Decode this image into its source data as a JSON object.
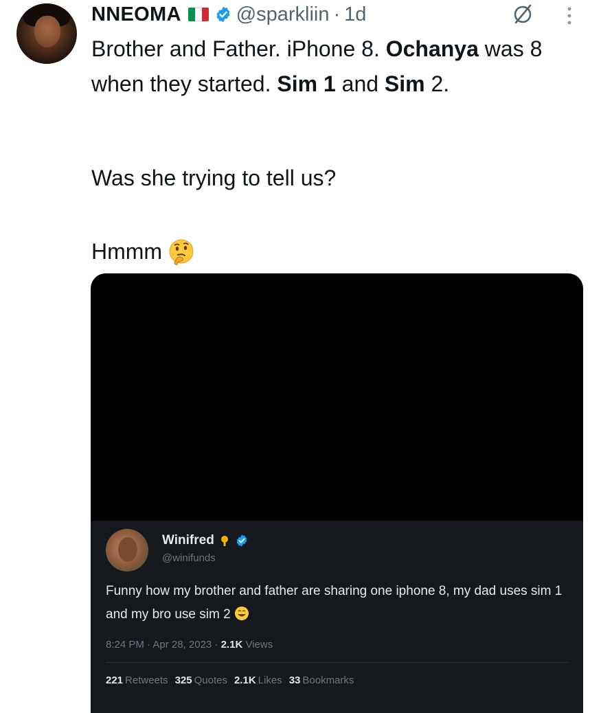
{
  "author": {
    "name": "NNEOMA",
    "handle": "@sparkliin",
    "separator": "·",
    "time": "1d"
  },
  "icons": {
    "flag": "italy-flag-icon",
    "verified": "verified-badge-icon",
    "grok": "grok-icon",
    "more": "more-vertical-icon",
    "emoji_thinking": "thinking-face-emoji",
    "emoji_laugh": "grinning-sweat-emoji",
    "sun": "sun-icon"
  },
  "tweet": {
    "p1": {
      "t1": "Brother and Father. iPhone 8. ",
      "b1": "Ochanya",
      "t2": " was 8 when they started. ",
      "b2": "Sim 1",
      "t3": " and ",
      "b3": "Sim",
      "t4": " 2."
    },
    "p2": "Was she trying to tell us?",
    "p3": "Hmmm"
  },
  "embedded": {
    "name": "Winifred",
    "handle": "@winifunds",
    "text": "Funny how my brother and father are sharing one iphone 8, my dad uses sim 1 and my bro use sim 2",
    "timestamp": "8:24 PM · Apr 28, 2023 · ",
    "views_count": "2.1K",
    "views_label": " Views",
    "stats": [
      {
        "count": "221",
        "label": "Retweets"
      },
      {
        "count": "325",
        "label": "Quotes"
      },
      {
        "count": "2.1K",
        "label": "Likes"
      },
      {
        "count": "33",
        "label": "Bookmarks"
      }
    ]
  },
  "colors": {
    "text": "#0f1419",
    "muted": "#536471",
    "verified": "#1d9bf0",
    "media_bg": "#000000",
    "card_bg": "#15181c"
  }
}
